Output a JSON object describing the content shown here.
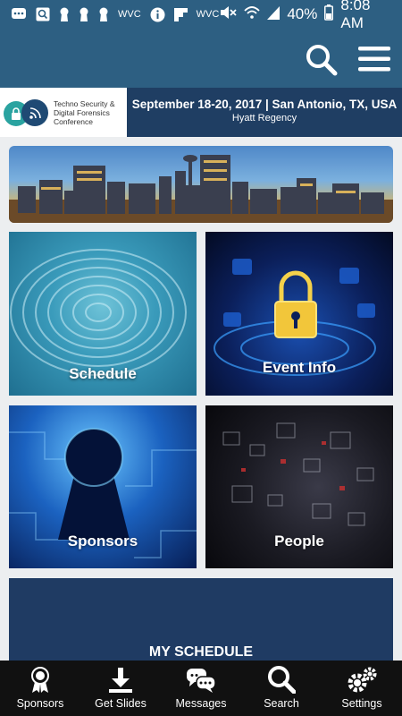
{
  "status_bar": {
    "carrier_1": "WVC",
    "carrier_2": "WVC",
    "battery": "40%",
    "time": "8:08 AM"
  },
  "app_bar": {},
  "banner": {
    "logo_text": "Techno Security & Digital Forensics Conference",
    "dates": "September 18-20, 2017 | San Antonio, TX, USA",
    "venue": "Hyatt Regency"
  },
  "tiles": {
    "schedule": "Schedule",
    "event_info": "Event Info",
    "sponsors": "Sponsors",
    "people": "People"
  },
  "my_schedule": {
    "title": "MY SCHEDULE"
  },
  "bottom_nav": {
    "sponsors": "Sponsors",
    "get_slides": "Get Slides",
    "messages": "Messages",
    "search": "Search",
    "settings": "Settings"
  }
}
